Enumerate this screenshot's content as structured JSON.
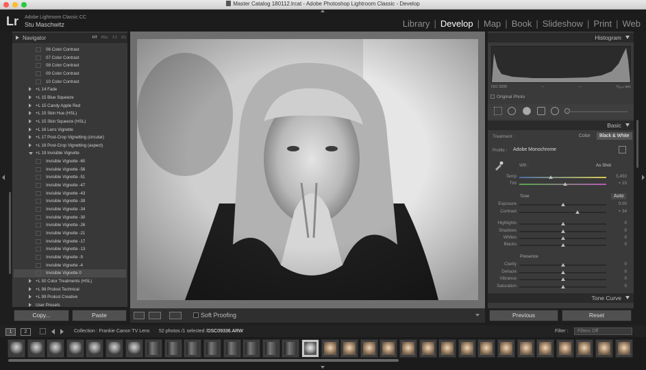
{
  "window": {
    "title": "Master Catalog 180112.lrcat - Adobe Photoshop Lightroom Classic - Develop"
  },
  "identity": {
    "logo": "Lr",
    "app_name": "Adobe Lightroom Classic CC",
    "user": "Stu Maschwitz"
  },
  "modules": [
    {
      "label": "Library",
      "active": false
    },
    {
      "label": "Develop",
      "active": true
    },
    {
      "label": "Map",
      "active": false
    },
    {
      "label": "Book",
      "active": false
    },
    {
      "label": "Slideshow",
      "active": false
    },
    {
      "label": "Print",
      "active": false
    },
    {
      "label": "Web",
      "active": false
    }
  ],
  "navigator": {
    "title": "Navigator",
    "zoom": [
      "FIT",
      "FILL",
      "1:1",
      "3:1"
    ]
  },
  "presets": [
    {
      "label": "06 Color Contrast",
      "type": "item"
    },
    {
      "label": "07 Color Contrast",
      "type": "item"
    },
    {
      "label": "08 Color Contrast",
      "type": "item"
    },
    {
      "label": "09 Color Contrast",
      "type": "item"
    },
    {
      "label": "10 Color Contrast",
      "type": "item"
    },
    {
      "label": "+L 14 Fade",
      "type": "folder"
    },
    {
      "label": "+L 15 Blue Squeeze",
      "type": "folder"
    },
    {
      "label": "+L 15 Candy Apple Red",
      "type": "folder"
    },
    {
      "label": "+L 15 Skin Hue (HSL)",
      "type": "folder"
    },
    {
      "label": "+L 15 Skin Squeeze (HSL)",
      "type": "folder"
    },
    {
      "label": "+L 16 Lens Vignette",
      "type": "folder"
    },
    {
      "label": "+L 17 Post-Crop Vignetting (circular)",
      "type": "folder"
    },
    {
      "label": "+L 18 Post-Crop Vignetting (aspect)",
      "type": "folder"
    },
    {
      "label": "+L 19 Invisible Vignette",
      "type": "open"
    },
    {
      "label": "Invisible Vignette -60",
      "type": "item"
    },
    {
      "label": "Invisible Vignette -56",
      "type": "item"
    },
    {
      "label": "Invisible Vignette -51",
      "type": "item"
    },
    {
      "label": "Invisible Vignette -47",
      "type": "item"
    },
    {
      "label": "Invisible Vignette -43",
      "type": "item"
    },
    {
      "label": "Invisible Vignette -39",
      "type": "item"
    },
    {
      "label": "Invisible Vignette -34",
      "type": "item"
    },
    {
      "label": "Invisible Vignette -30",
      "type": "item"
    },
    {
      "label": "Invisible Vignette -26",
      "type": "item"
    },
    {
      "label": "Invisible Vignette -21",
      "type": "item"
    },
    {
      "label": "Invisible Vignette -17",
      "type": "item"
    },
    {
      "label": "Invisible Vignette -13",
      "type": "item"
    },
    {
      "label": "Invisible Vignette -9",
      "type": "item"
    },
    {
      "label": "Invisible Vignette -4",
      "type": "item"
    },
    {
      "label": "Invisible Vignette 0",
      "type": "item",
      "highlighted": true
    },
    {
      "label": "+L 50 Color Treatments (HSL)",
      "type": "folder"
    },
    {
      "label": "+L 98 Prolost Technical",
      "type": "folder"
    },
    {
      "label": "+L 99 Prolost Creative",
      "type": "folder"
    },
    {
      "label": "User Presets",
      "type": "folder"
    }
  ],
  "left_buttons": {
    "copy": "Copy...",
    "paste": "Paste"
  },
  "toolbar": {
    "soft_proofing": "Soft Proofing"
  },
  "histogram": {
    "title": "Histogram",
    "iso": "ISO 3200",
    "dash1": "--",
    "dash2": "--",
    "shutter": "¹⁄₁₆₀₀ sec",
    "original_photo": "Original Photo"
  },
  "basic": {
    "title": "Basic",
    "treatment_label": "Treatment :",
    "treatment_color": "Color",
    "treatment_bw": "Black & White",
    "profile_label": "Profile :",
    "profile_value": "Adobe Monochrome",
    "wb_label": "WB :",
    "wb_value": "As Shot",
    "tone_label": "Tone",
    "auto_label": "Auto",
    "presence_label": "Presence"
  },
  "sliders": [
    {
      "name": "temp",
      "label": "Temp",
      "value": "5,450",
      "pos": 0.36
    },
    {
      "name": "tint",
      "label": "Tint",
      "value": "+ 10",
      "pos": 0.53
    },
    {
      "name": "exposure",
      "label": "Exposure",
      "value": "0.00",
      "pos": 0.5
    },
    {
      "name": "contrast",
      "label": "Contrast",
      "value": "+ 34",
      "pos": 0.67
    },
    {
      "name": "highlights",
      "label": "Highlights",
      "value": "0",
      "pos": 0.5
    },
    {
      "name": "shadows",
      "label": "Shadows",
      "value": "0",
      "pos": 0.5
    },
    {
      "name": "whites",
      "label": "Whites",
      "value": "0",
      "pos": 0.5
    },
    {
      "name": "blacks",
      "label": "Blacks",
      "value": "0",
      "pos": 0.5
    },
    {
      "name": "clarity",
      "label": "Clarity",
      "value": "0",
      "pos": 0.5
    },
    {
      "name": "dehaze",
      "label": "Dehaze",
      "value": "0",
      "pos": 0.5
    },
    {
      "name": "vibrance",
      "label": "Vibrance",
      "value": "0",
      "pos": 0.5
    },
    {
      "name": "saturation",
      "label": "Saturation",
      "value": "0",
      "pos": 0.5
    }
  ],
  "tone_curve": {
    "title": "Tone Curve"
  },
  "right_buttons": {
    "previous": "Previous",
    "reset": "Reset"
  },
  "filmbar": {
    "page1": "1",
    "page2": "2",
    "collection": "Collection : Frankie Canon TV Lens",
    "count": "52 photos /1 selected /",
    "filename": "DSC09336.ARW",
    "filter_label": "Filter :",
    "filter_value": "Filters Off"
  }
}
